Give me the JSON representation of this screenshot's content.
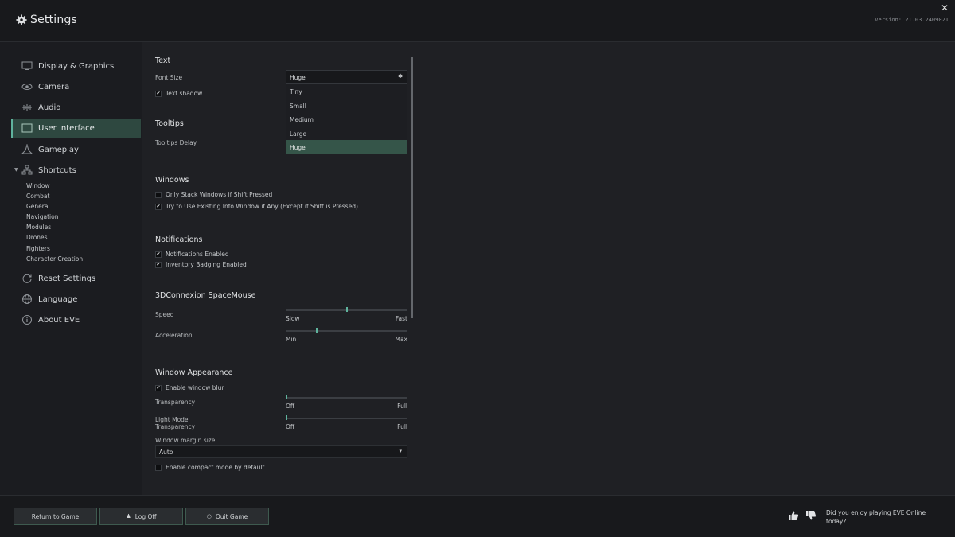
{
  "window": {
    "title": "Settings",
    "version": "Version: 21.03.2409021",
    "close_glyph": "✕"
  },
  "sidebar": {
    "items": [
      {
        "label": "Display & Graphics",
        "icon": "monitor-icon"
      },
      {
        "label": "Camera",
        "icon": "eye-icon"
      },
      {
        "label": "Audio",
        "icon": "waveform-icon"
      },
      {
        "label": "User Interface",
        "icon": "window-icon",
        "active": true
      },
      {
        "label": "Gameplay",
        "icon": "ship-icon"
      },
      {
        "label": "Shortcuts",
        "icon": "hierarchy-icon"
      },
      {
        "label": "Reset Settings",
        "icon": "refresh-icon"
      },
      {
        "label": "Language",
        "icon": "globe-icon"
      },
      {
        "label": "About EVE",
        "icon": "info-icon"
      }
    ],
    "shortcut_subitems": [
      "Window",
      "Combat",
      "General",
      "Navigation",
      "Modules",
      "Drones",
      "Fighters",
      "Character Creation"
    ]
  },
  "text": {
    "title": "Text",
    "font_size_label": "Font Size",
    "font_size_value": "Huge",
    "font_size_options": [
      "Tiny",
      "Small",
      "Medium",
      "Large",
      "Huge"
    ],
    "text_shadow_label": "Text shadow",
    "text_shadow_checked": true
  },
  "tooltips": {
    "title": "Tooltips",
    "delay_label": "Tooltips Delay"
  },
  "windows": {
    "title": "Windows",
    "stack_label": "Only Stack Windows if Shift Pressed",
    "stack_checked": false,
    "existing_info_label": "Try to Use Existing Info Window if Any (Except if Shift is Pressed)",
    "existing_info_checked": true
  },
  "notifications": {
    "title": "Notifications",
    "enabled_label": "Notifications Enabled",
    "enabled_checked": true,
    "badging_label": "Inventory Badging Enabled",
    "badging_checked": true
  },
  "spacemouse": {
    "title": "3DConnexion SpaceMouse",
    "speed_label": "Speed",
    "speed_min": "Slow",
    "speed_max": "Fast",
    "speed_value": 0.5,
    "accel_label": "Acceleration",
    "accel_min": "Min",
    "accel_max": "Max",
    "accel_value": 0.25
  },
  "appearance": {
    "title": "Window Appearance",
    "blur_label": "Enable window blur",
    "blur_checked": true,
    "transparency_label": "Transparency",
    "transparency_min": "Off",
    "transparency_max": "Full",
    "transparency_value": 0,
    "light_mode_label_1": "Light Mode",
    "light_mode_label_2": "Transparency",
    "light_transparency_min": "Off",
    "light_transparency_max": "Full",
    "light_transparency_value": 0,
    "margin_label": "Window margin size",
    "margin_value": "Auto",
    "compact_label": "Enable compact mode by default",
    "compact_checked": false
  },
  "footer": {
    "return_label": "Return to Game",
    "logoff_label": "Log Off",
    "quit_label": "Quit Game",
    "feedback_line1": "Did you enjoy playing EVE Online",
    "feedback_line2": "today?"
  },
  "colors": {
    "accent": "#5fb39d",
    "active_nav": "#2e4840",
    "selected_option": "#355549"
  }
}
